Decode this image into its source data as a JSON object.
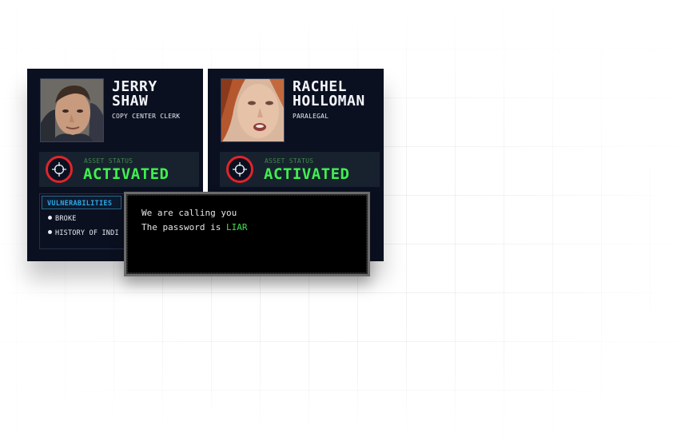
{
  "cards": [
    {
      "name_line1": "JERRY",
      "name_line2": "SHAW",
      "role": "COPY CENTER CLERK",
      "status_label": "ASSET STATUS",
      "status_value": "ACTIVATED",
      "vulnerabilities": {
        "title": "VULNERABILITIES",
        "items": [
          "BROKE",
          "HISTORY OF INDI"
        ]
      }
    },
    {
      "name_line1": "RACHEL",
      "name_line2": "HOLLOMAN",
      "role": "PARALEGAL",
      "status_label": "ASSET STATUS",
      "status_value": "ACTIVATED"
    }
  ],
  "terminal": {
    "line1": "We are calling you",
    "line2_prefix": "The password is ",
    "password": "LIAR"
  },
  "colors": {
    "card_bg": "#0b1020",
    "status_green": "#3ff04f",
    "target_red": "#e0242b",
    "vuln_blue": "#2fa8e6",
    "terminal_bg": "#000000"
  },
  "icons": [
    "crosshair-icon",
    "bullet-icon"
  ]
}
